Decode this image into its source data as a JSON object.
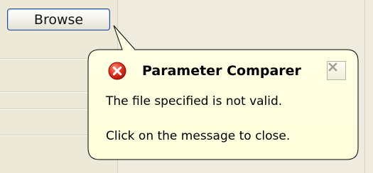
{
  "browse_button": {
    "label": "Browse"
  },
  "balloon": {
    "title": "Parameter Comparer",
    "icon": "error-icon",
    "close_icon": "close-icon",
    "message_line1": "The file specified is not valid.",
    "message_line2": "Click on the message to close.",
    "background_color": "#ffffe1",
    "border_color": "#000000"
  }
}
